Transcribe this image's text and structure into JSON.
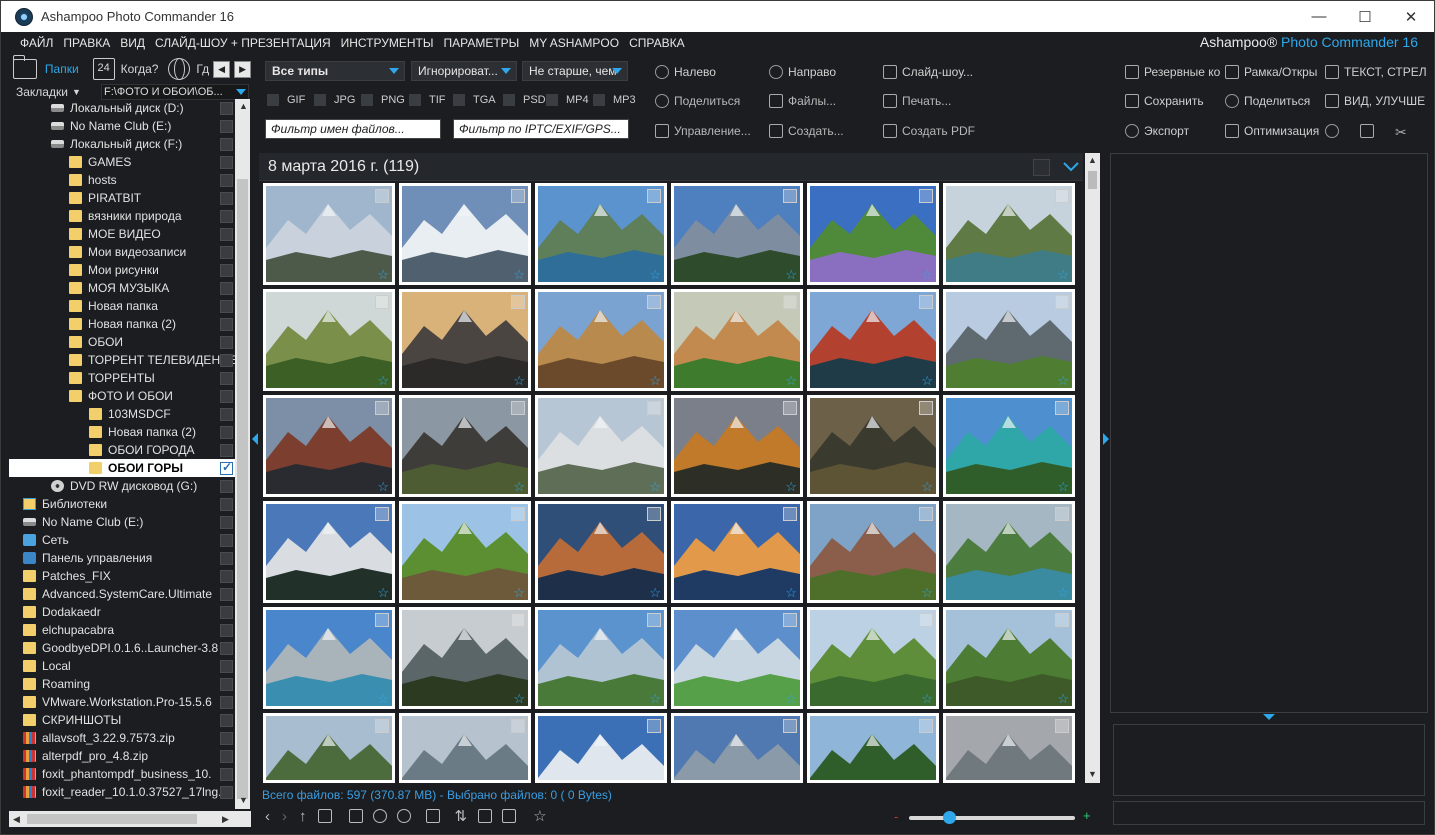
{
  "window": {
    "title": "Ashampoo Photo Commander 16",
    "brand_prefix": "Ashampoo®",
    "brand_name": "Photo Commander 16",
    "minimize": "—",
    "maximize": "☐",
    "close": "✕"
  },
  "menu": [
    "ФАЙЛ",
    "ПРАВКА",
    "ВИД",
    "СЛАЙД-ШОУ + ПРЕЗЕНТАЦИЯ",
    "ИНСТРУМЕНТЫ",
    "ПАРАМЕТРЫ",
    "MY ASHAMPOO",
    "СПРАВКА"
  ],
  "left": {
    "tabs": {
      "folders": "Папки",
      "calendar_day": "24",
      "when": "Когда?",
      "where": "Гд"
    },
    "bookmarks": "Закладки",
    "path": "F:\\ФОТО И ОБОИ\\ОБ...",
    "tree": [
      {
        "label": "Локальный диск (D:)",
        "icon": "drive",
        "indent": 1
      },
      {
        "label": "No Name Club (E:)",
        "icon": "drive",
        "indent": 1
      },
      {
        "label": "Локальный диск (F:)",
        "icon": "drive",
        "indent": 1
      },
      {
        "label": "GAMES",
        "icon": "folder",
        "indent": 2
      },
      {
        "label": "hosts",
        "icon": "folder",
        "indent": 2
      },
      {
        "label": "PIRATBIT",
        "icon": "folder",
        "indent": 2
      },
      {
        "label": "вязники природа",
        "icon": "folder",
        "indent": 2
      },
      {
        "label": "МОЕ ВИДЕО",
        "icon": "folder",
        "indent": 2
      },
      {
        "label": "Мои видеозаписи",
        "icon": "folder",
        "indent": 2
      },
      {
        "label": "Мои рисунки",
        "icon": "folder",
        "indent": 2
      },
      {
        "label": "МОЯ МУЗЫКА",
        "icon": "folder",
        "indent": 2
      },
      {
        "label": "Новая папка",
        "icon": "folder",
        "indent": 2
      },
      {
        "label": "Новая папка (2)",
        "icon": "folder",
        "indent": 2
      },
      {
        "label": "ОБОИ",
        "icon": "folder",
        "indent": 2
      },
      {
        "label": "ТОРРЕНТ ТЕЛЕВИДЕНИЕ",
        "icon": "folder",
        "indent": 2
      },
      {
        "label": "ТОРРЕНТЫ",
        "icon": "folder",
        "indent": 2
      },
      {
        "label": "ФОТО И ОБОИ",
        "icon": "folder",
        "indent": 2
      },
      {
        "label": "103MSDCF",
        "icon": "folder",
        "indent": 3
      },
      {
        "label": "Новая папка (2)",
        "icon": "folder",
        "indent": 3
      },
      {
        "label": "ОБОИ ГОРОДА",
        "icon": "folder",
        "indent": 3
      },
      {
        "label": "ОБОИ ГОРЫ",
        "icon": "folder",
        "indent": 3,
        "selected": true
      },
      {
        "label": "DVD RW дисковод (G:)",
        "icon": "dvd",
        "indent": 1
      },
      {
        "label": "Библиотеки",
        "icon": "lib",
        "indent": 0
      },
      {
        "label": "No Name Club (E:)",
        "icon": "drive",
        "indent": 0
      },
      {
        "label": "Сеть",
        "icon": "net",
        "indent": 0
      },
      {
        "label": "Панель управления",
        "icon": "cp",
        "indent": 0
      },
      {
        "label": "Patches_FIX",
        "icon": "folder",
        "indent": 0
      },
      {
        "label": "Advanced.SystemCare.Ultimate",
        "icon": "folder",
        "indent": 0
      },
      {
        "label": "Dodakaedr",
        "icon": "folder",
        "indent": 0
      },
      {
        "label": "elchupacabra",
        "icon": "folder",
        "indent": 0
      },
      {
        "label": "GoodbyeDPI.0.1.6..Launcher-3.8",
        "icon": "folder",
        "indent": 0
      },
      {
        "label": "Local",
        "icon": "folder",
        "indent": 0
      },
      {
        "label": "Roaming",
        "icon": "folder",
        "indent": 0
      },
      {
        "label": "VMware.Workstation.Pro-15.5.6",
        "icon": "folder",
        "indent": 0
      },
      {
        "label": "СКРИНШОТЫ",
        "icon": "folder",
        "indent": 0
      },
      {
        "label": "allavsoft_3.22.9.7573.zip",
        "icon": "zip",
        "indent": 0
      },
      {
        "label": "alterpdf_pro_4.8.zip",
        "icon": "zip",
        "indent": 0
      },
      {
        "label": "foxit_phantompdf_business_10.",
        "icon": "zip",
        "indent": 0
      },
      {
        "label": "foxit_reader_10.1.0.37527_17lng.",
        "icon": "zip",
        "indent": 0
      }
    ]
  },
  "filters": {
    "type_select": "Все типы",
    "ignore_select": "Игнорироват...",
    "age_select": "Не старше, чем",
    "types": [
      "GIF",
      "JPG",
      "PNG",
      "TIF",
      "TGA",
      "PSD",
      "MP4",
      "MP3"
    ],
    "name_placeholder": "Фильтр имен файлов...",
    "meta_placeholder": "Фильтр по IPTC/EXIF/GPS..."
  },
  "actions": {
    "left": "Налево",
    "right": "Направо",
    "slideshow": "Слайд-шоу...",
    "share": "Поделиться",
    "files": "Файлы...",
    "print": "Печать...",
    "manage": "Управление...",
    "create": "Создать...",
    "create_pdf": "Создать PDF"
  },
  "right_actions": {
    "backup": "Резервные ко",
    "frame": "Рамка/Откры",
    "text": "ТЕКСТ, СТРЕЛ",
    "save": "Сохранить",
    "share": "Поделиться",
    "view": "ВИД, УЛУЧШЕ",
    "export": "Экспорт",
    "optimize": "Оптимизация"
  },
  "group": {
    "title": "8 марта 2016 г. (119)"
  },
  "thumbnails": [
    {
      "sky": "#9fb6cc",
      "land": "#c9d2dc",
      "ground": "#4d5a4a"
    },
    {
      "sky": "#6f8fb8",
      "land": "#e9eef3",
      "ground": "#51606e"
    },
    {
      "sky": "#5b93cf",
      "land": "#5e7f5a",
      "ground": "#2f6e99"
    },
    {
      "sky": "#4e7fbf",
      "land": "#7e8da0",
      "ground": "#2e4b2b"
    },
    {
      "sky": "#3a6fc2",
      "land": "#4f8a3a",
      "ground": "#8a6fc0"
    },
    {
      "sky": "#c7d3dc",
      "land": "#5f7a45",
      "ground": "#3f7c86"
    },
    {
      "sky": "#cfd8d6",
      "land": "#7a8f4a",
      "ground": "#3b5f25"
    },
    {
      "sky": "#d9b27a",
      "land": "#4a4540",
      "ground": "#2b2a28"
    },
    {
      "sky": "#7aa3d1",
      "land": "#b98a4d",
      "ground": "#6a4a2a"
    },
    {
      "sky": "#c5c9b8",
      "land": "#c28a4e",
      "ground": "#3e7b2c"
    },
    {
      "sky": "#7fa7d6",
      "land": "#b2412f",
      "ground": "#1f3b48"
    },
    {
      "sky": "#b8cbe0",
      "land": "#5f6a70",
      "ground": "#4f7d31"
    },
    {
      "sky": "#7c8fa6",
      "land": "#7b3e2f",
      "ground": "#2a2b30"
    },
    {
      "sky": "#8b97a3",
      "land": "#3f3d3a",
      "ground": "#4e5c34"
    },
    {
      "sky": "#b7c6d4",
      "land": "#dcdfe2",
      "ground": "#5f6f57"
    },
    {
      "sky": "#7a7f8a",
      "land": "#c07a2a",
      "ground": "#2d2f26"
    },
    {
      "sky": "#6d6049",
      "land": "#3a3a2e",
      "ground": "#5d5335"
    },
    {
      "sky": "#4e8fcf",
      "land": "#2fa6a8",
      "ground": "#2f5e2b"
    },
    {
      "sky": "#4a78b8",
      "land": "#d9dde2",
      "ground": "#22302a"
    },
    {
      "sky": "#9cc3e6",
      "land": "#5b8f31",
      "ground": "#6c5a3a"
    },
    {
      "sky": "#2f4f79",
      "land": "#b86b3a",
      "ground": "#1d2f49"
    },
    {
      "sky": "#3b66a9",
      "land": "#e29a4a",
      "ground": "#1f3a63"
    },
    {
      "sky": "#7fa3c7",
      "land": "#8a5e4a",
      "ground": "#4d6f2a"
    },
    {
      "sky": "#a6b7c4",
      "land": "#4d7c3f",
      "ground": "#3a8aa0"
    },
    {
      "sky": "#4a86cc",
      "land": "#a8b3ba",
      "ground": "#3a8fb0"
    },
    {
      "sky": "#c7ccd0",
      "land": "#5b6669",
      "ground": "#2c3a22"
    },
    {
      "sky": "#5b93cf",
      "land": "#b0c3d3",
      "ground": "#4a7a3a"
    },
    {
      "sky": "#5c8fcc",
      "land": "#c8d6e2",
      "ground": "#57a04a"
    },
    {
      "sky": "#bcd2e4",
      "land": "#5e8e3a",
      "ground": "#3b6a2e"
    },
    {
      "sky": "#a5c1d9",
      "land": "#4d7c34",
      "ground": "#3d5a28"
    },
    {
      "sky": "#a9bdd0",
      "land": "#4c6c3d",
      "ground": "#3b5a2f"
    },
    {
      "sky": "#b6c2cd",
      "land": "#6b7b86",
      "ground": "#2a3a27"
    },
    {
      "sky": "#3b6fb6",
      "land": "#dfe6ee",
      "ground": "#3a4f5c"
    },
    {
      "sky": "#4f79b0",
      "land": "#8a9aa8",
      "ground": "#3aa0b0"
    },
    {
      "sky": "#8fb5d8",
      "land": "#2f5e2b",
      "ground": "#d8d4c2"
    },
    {
      "sky": "#a4a7ab",
      "land": "#707a7e",
      "ground": "#4a5a3d"
    }
  ],
  "status": {
    "text": "Всего файлов: 597 (370.87 MB) - Выбрано файлов: 0 (   0 Bytes)"
  },
  "zoom": {
    "minus": "-",
    "plus": "+",
    "level": 0.22
  }
}
